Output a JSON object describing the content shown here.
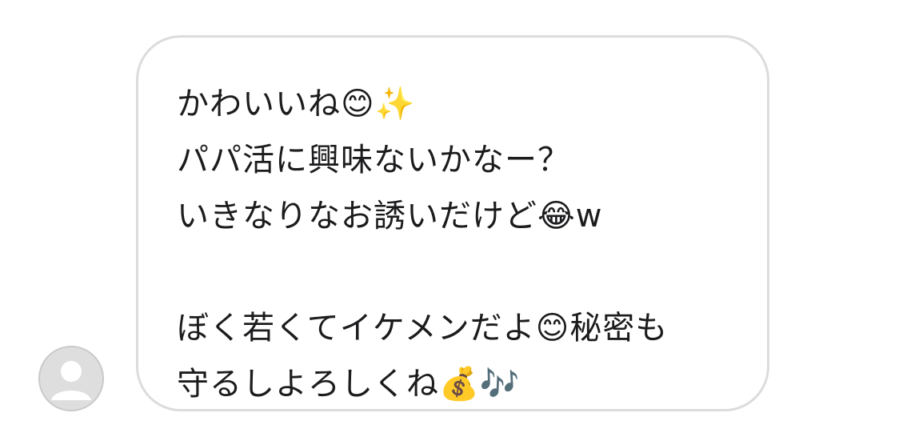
{
  "message": {
    "lines": [
      "かわいいね😊✨",
      "パパ活に興味ないかなー？",
      "いきなりなお誘いだけど😂w",
      "",
      "ぼく若くてイケメンだよ😊秘密も",
      "守るしよろしくね💰🎶"
    ]
  },
  "avatar": {
    "icon": "default-user-avatar-icon",
    "color": "#dedede"
  },
  "colors": {
    "bubble_border": "#dcdcdc",
    "text": "#1c1c1e"
  }
}
